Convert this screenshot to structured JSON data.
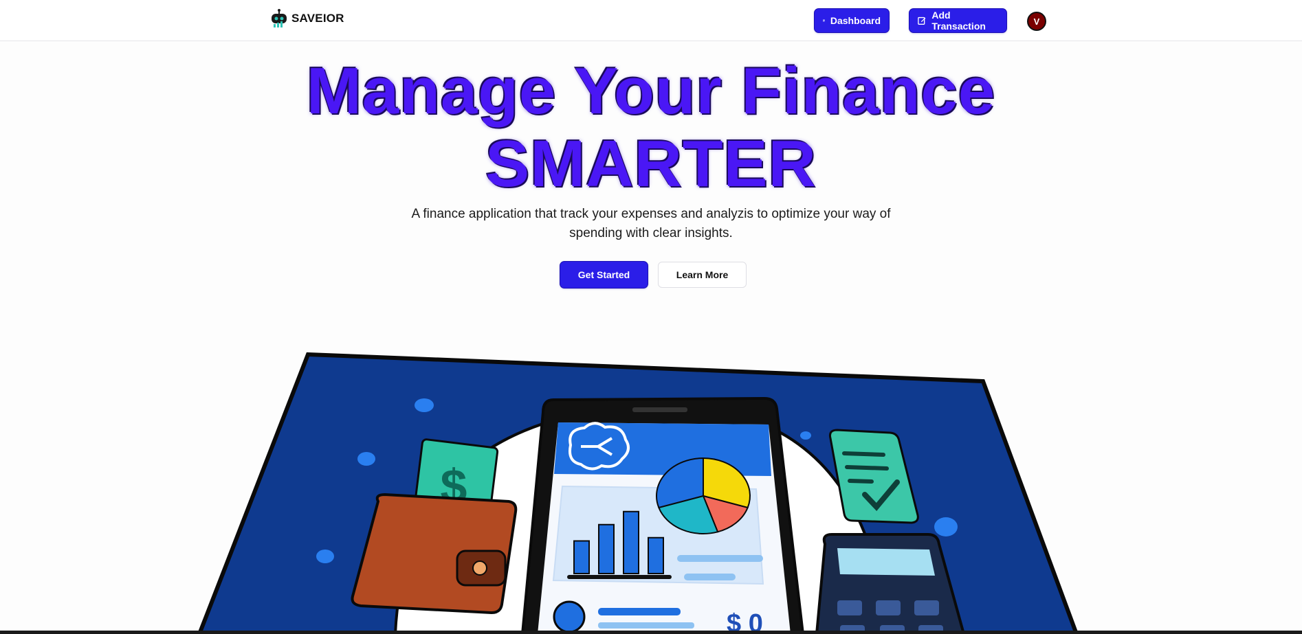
{
  "brand": {
    "name": "SAVEIOR",
    "logo_icon": "robot-chart-icon"
  },
  "nav": {
    "dashboard_label": "Dashboard",
    "dashboard_icon": "grid-icon",
    "add_transaction_label": "Add Transaction",
    "add_transaction_icon": "edit-icon",
    "avatar_initial": "V"
  },
  "hero": {
    "title_line1": "Manage Your Finance",
    "title_line2": "SMARTER",
    "subtitle": "A finance application that track your expenses and analyzis to optimize your way of spending with clear insights.",
    "primary_cta": "Get Started",
    "secondary_cta": "Learn More"
  },
  "illustration": {
    "phone_balance": "$ 0",
    "pie_values": [
      0.3,
      0.15,
      0.25,
      0.3
    ],
    "bar_levels": [
      0.5,
      0.75,
      0.95,
      0.55
    ]
  },
  "colors": {
    "accent": "#2b1ee8",
    "title": "#4a17f5",
    "panel": "#0f3a8f",
    "teal": "#22b8a4",
    "wallet": "#b24a22"
  }
}
